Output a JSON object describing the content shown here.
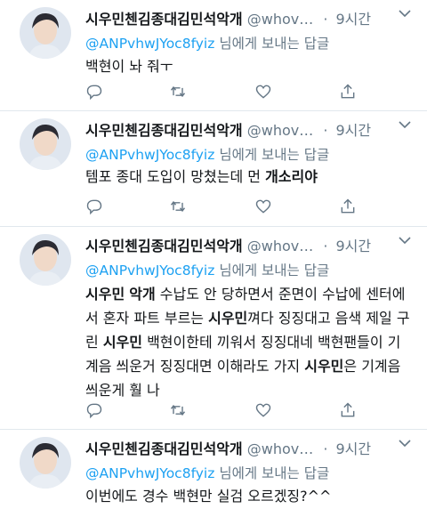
{
  "tweets": [
    {
      "name": "시우민첸김종대김민석악개",
      "handle": "@whov…",
      "dot": "·",
      "time": "9시간",
      "reply_mention": "@ANPvhwJYoc8fyiz",
      "reply_suffix": "님에게 보내는 답글",
      "segments": [
        {
          "t": "백현이 놔 줘ㅜ",
          "b": false
        }
      ]
    },
    {
      "name": "시우민첸김종대김민석악개",
      "handle": "@whov…",
      "dot": "·",
      "time": "9시간",
      "reply_mention": "@ANPvhwJYoc8fyiz",
      "reply_suffix": "님에게 보내는 답글",
      "segments": [
        {
          "t": "템포 종대 도입이 망쳤는데 먼 ",
          "b": false
        },
        {
          "t": "개소리야",
          "b": true
        }
      ]
    },
    {
      "name": "시우민첸김종대김민석악개",
      "handle": "@whov…",
      "dot": "·",
      "time": "9시간",
      "reply_mention": "@ANPvhwJYoc8fyiz",
      "reply_suffix": "님에게 보내는 답글",
      "segments": [
        {
          "t": "시우민",
          "b": true
        },
        {
          "t": " ",
          "b": false
        },
        {
          "t": "악개",
          "b": true
        },
        {
          "t": " 수납도 안 당하면서 준면이 수납에 센터에서 혼자 파트 부르는 ",
          "b": false
        },
        {
          "t": "시우민",
          "b": true
        },
        {
          "t": "껴다 징징대고 음색 제일 구린 ",
          "b": false
        },
        {
          "t": "시우민",
          "b": true
        },
        {
          "t": " 백현이한테 끼워서 징징대네 백현팬들이 기계음 씌운거 징징대면 이해라도 가지 ",
          "b": false
        },
        {
          "t": "시우민",
          "b": true
        },
        {
          "t": "은 기계음 씌운게 훨 나",
          "b": false
        }
      ]
    },
    {
      "name": "시우민첸김종대김민석악개",
      "handle": "@whov…",
      "dot": "·",
      "time": "9시간",
      "reply_mention": "@ANPvhwJYoc8fyiz",
      "reply_suffix": "님에게 보내는 답글",
      "segments": [
        {
          "t": "이번에도 경수 백현만 실검 오르겠징?^^",
          "b": false
        }
      ]
    }
  ],
  "icons": {
    "chevron": "chevron-down-icon",
    "reply": "reply-icon",
    "retweet": "retweet-icon",
    "like": "heart-icon",
    "share": "share-icon"
  }
}
